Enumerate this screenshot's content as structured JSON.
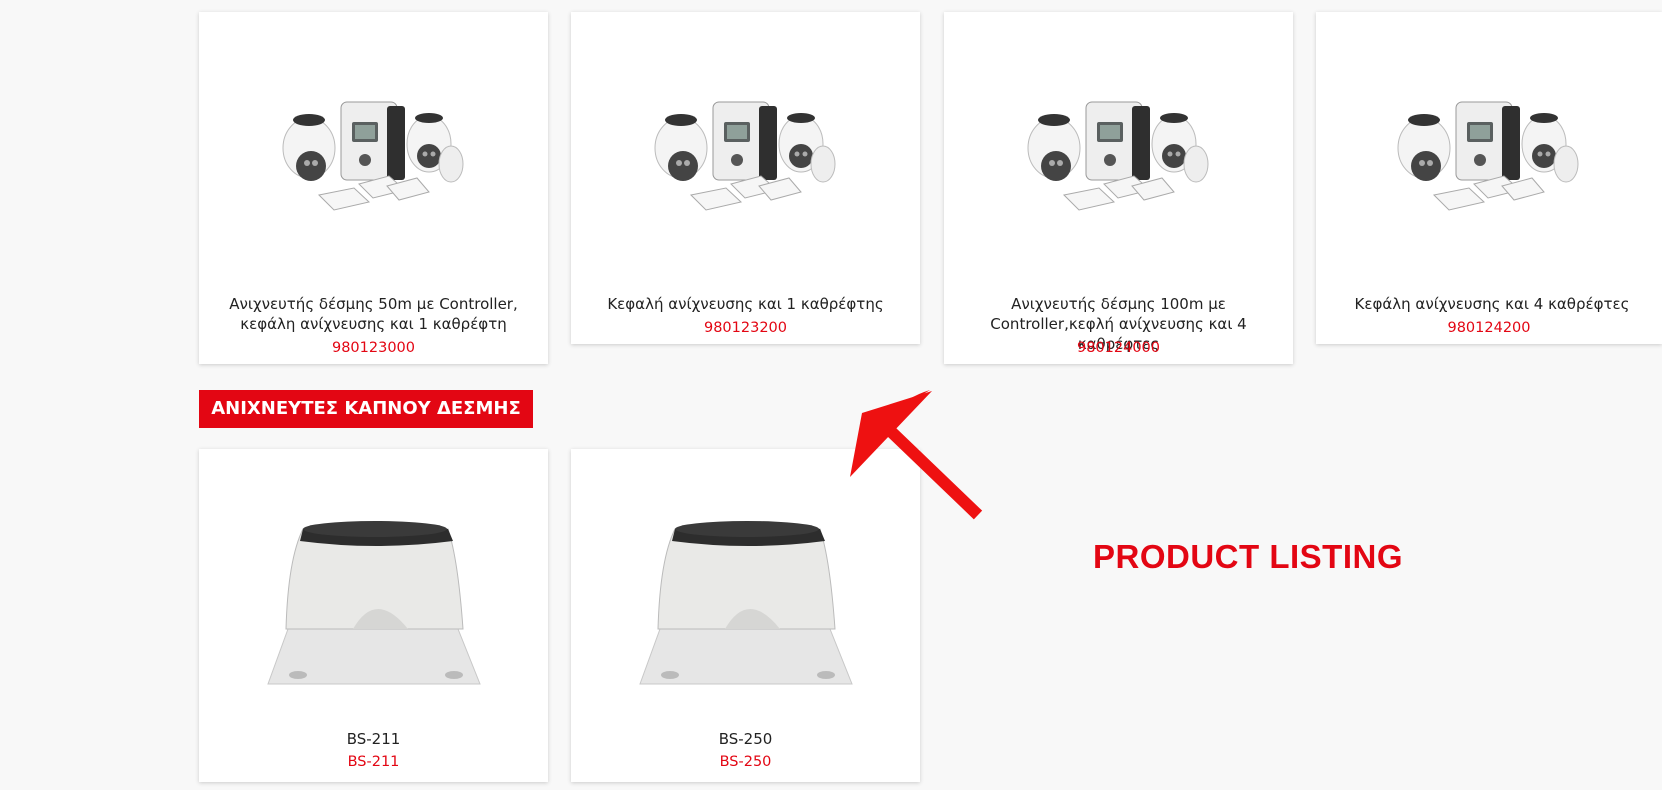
{
  "products_top": [
    {
      "title": "Ανιχνευτής δέσμης 50m με Controller, κεφάλη ανίχνευσης και 1 καθρέφτη",
      "code": "980123000"
    },
    {
      "title": "Κεφαλή ανίχνευσης και 1 καθρέφτης",
      "code": "980123200"
    },
    {
      "title": "Ανιχνευτής δέσμης 100m με Controller,κεφλή ανίχνευσης και 4 καθρέφτες",
      "code": "980124000"
    },
    {
      "title": "Κεφάλη ανίχνευσης και 4 καθρέφτες",
      "code": "980124200"
    }
  ],
  "section": {
    "title": "ΑΝΙΧΝΕΥΤΕΣ ΚΑΠΝΟΥ ΔΕΣΜΗΣ"
  },
  "products_bottom": [
    {
      "title": "BS-211",
      "code": "BS-211"
    },
    {
      "title": "BS-250",
      "code": "BS-250"
    }
  ],
  "annotation": {
    "label": "PRODUCT LISTING"
  },
  "colors": {
    "accent": "#e30613",
    "background": "#f8f8f8"
  },
  "icons": {
    "product_image_kit": "beam-detector-kit-image",
    "product_image_unit": "beam-detector-unit-image",
    "arrow": "arrow-up-left-icon"
  }
}
